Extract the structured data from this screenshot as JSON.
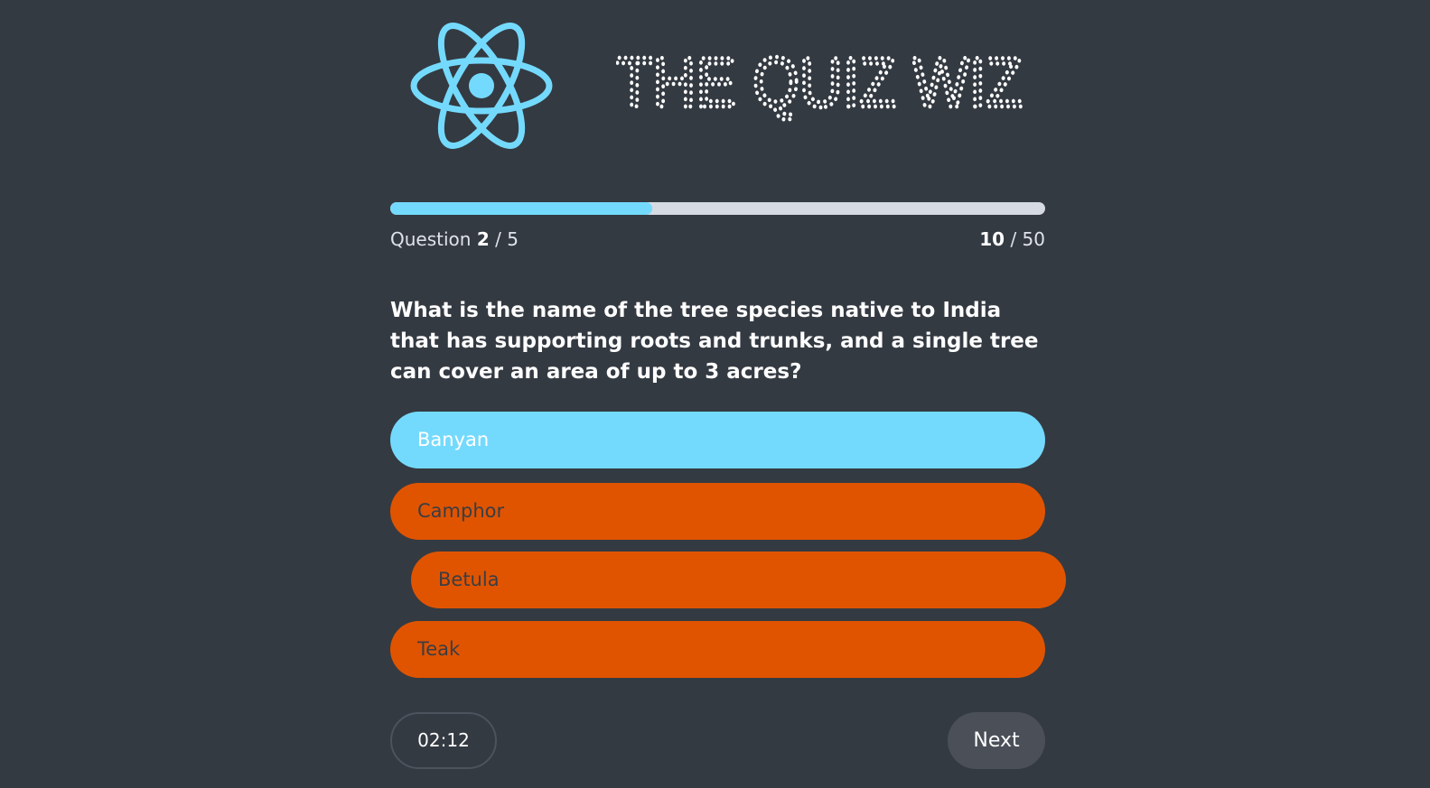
{
  "header": {
    "logo_icon": "react-atom-icon",
    "title": "THE QUIZ WIZ"
  },
  "progress": {
    "fraction": 0.4,
    "question_label": "Question",
    "question_current": "2",
    "question_separator": " / ",
    "question_total": "5",
    "score_current": "10",
    "score_separator": " / ",
    "score_total": "50"
  },
  "question": {
    "text": "What is the name of the tree species native to India that has supporting roots and trunks, and a single tree can cover an area of up to 3 acres?"
  },
  "answers": [
    {
      "label": "Banyan",
      "state": "correct"
    },
    {
      "label": "Camphor",
      "state": "wrong"
    },
    {
      "label": "Betula",
      "state": "wrong"
    },
    {
      "label": "Teak",
      "state": "wrong"
    }
  ],
  "footer": {
    "timer": "02:12",
    "next_label": "Next"
  },
  "colors": {
    "background": "#343a42",
    "accent": "#74dafd",
    "wrong": "#e05400",
    "track": "#d6dae2"
  }
}
